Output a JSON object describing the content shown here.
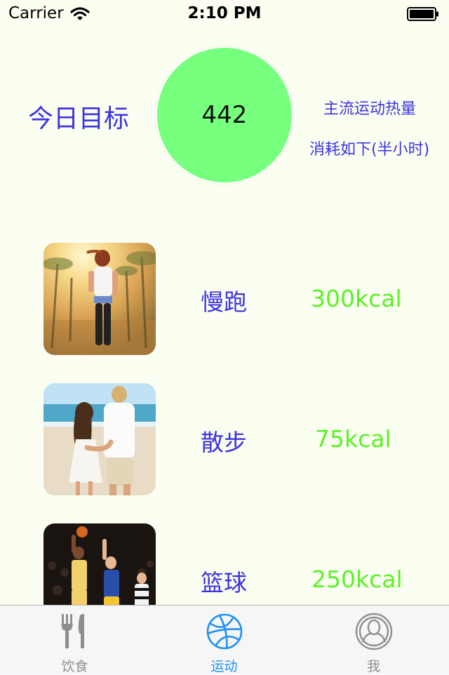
{
  "status_bar": {
    "carrier": "Carrier",
    "time": "2:10 PM"
  },
  "header": {
    "goal_label": "今日目标",
    "goal_value": "442",
    "goal_circle_color": "#77FF7E",
    "info_line1": "主流运动热量",
    "info_line2": "消耗如下(半小时)"
  },
  "activities": [
    {
      "name": "慢跑",
      "kcal": "300kcal",
      "image": "jogging-photo"
    },
    {
      "name": "散步",
      "kcal": "75kcal",
      "image": "walking-photo"
    },
    {
      "name": "篮球",
      "kcal": "250kcal",
      "image": "basketball-photo"
    }
  ],
  "tabs": [
    {
      "label": "饮食",
      "icon": "fork-knife-icon",
      "selected": false
    },
    {
      "label": "运动",
      "icon": "basketball-icon",
      "selected": true
    },
    {
      "label": "我",
      "icon": "profile-icon",
      "selected": false
    }
  ],
  "colors": {
    "background": "#FBFFF2",
    "label_blue": "#3D33E0",
    "kcal_green": "#5BF224",
    "tab_active": "#1E90F5",
    "tab_inactive": "#8E8E8E"
  }
}
